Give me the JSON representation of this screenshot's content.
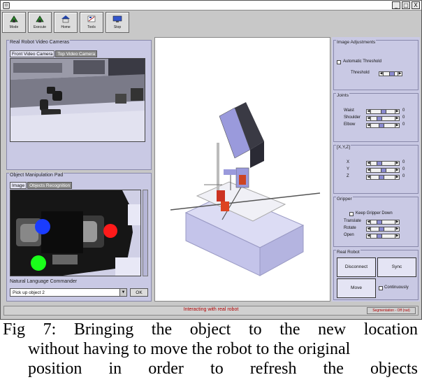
{
  "window": {
    "icon": "app-icon",
    "controls": [
      "_",
      "□",
      "X"
    ]
  },
  "toolbar": {
    "buttons": [
      {
        "label": "Mode",
        "icon": "green-arrow-icon"
      },
      {
        "label": "Execute",
        "icon": "green-arrow-icon"
      },
      {
        "label": "Home",
        "icon": "house-icon"
      },
      {
        "label": "Tools",
        "icon": "tools-icon"
      },
      {
        "label": "Stop",
        "icon": "monitor-icon"
      }
    ]
  },
  "cameras": {
    "title": "Real Robot Video Cameras",
    "tabs": [
      "Front Video Camera",
      "Top Video Camera"
    ]
  },
  "manipulation": {
    "title": "Object Manipulation Pad",
    "tabs": [
      "Image",
      "Objects Recognition"
    ]
  },
  "commander": {
    "title": "Natural Language Commander",
    "value": "Pick up object 2",
    "ok_label": "OK"
  },
  "image_adjustments": {
    "title": "Image Adjustments",
    "auto_threshold_label": "Automatic Threshold",
    "threshold_label": "Threshold"
  },
  "joints": {
    "title": "Joints",
    "rows": [
      {
        "label": "Waist",
        "value": "0.5",
        "value_readout": "0"
      },
      {
        "label": "Shoulder",
        "value": "0.3",
        "value_readout": "0"
      },
      {
        "label": "Elbow",
        "value": "0.4",
        "value_readout": "0"
      }
    ]
  },
  "xyz": {
    "title": "[X,Y,Z]",
    "rows": [
      {
        "label": "X",
        "value": "0.3",
        "value_readout": "0"
      },
      {
        "label": "Y",
        "value": "0.5",
        "value_readout": "0"
      },
      {
        "label": "Z",
        "value": "0.4",
        "value_readout": "0"
      }
    ]
  },
  "gripper": {
    "title": "Gripper",
    "keep_down_label": "Keep Gripper Down",
    "rows": [
      {
        "label": "Translate",
        "value": "0.3"
      },
      {
        "label": "Rotate",
        "value": "0.4"
      },
      {
        "label": "Open",
        "value": "0.3"
      }
    ]
  },
  "real_robot": {
    "title": "Real Robot",
    "disconnect_label": "Disconnect",
    "sync_label": "Sync",
    "move_label": "Move",
    "continuously_label": "Continuously"
  },
  "status": {
    "text": "Interacting with real robot",
    "right": "Segmentation - Off (nat)"
  },
  "caption": {
    "line1": "Fig 7: Bringing the object to the new location",
    "line2": "without having to move the robot to the original",
    "line3": "position in order to refresh the objects"
  },
  "colors": {
    "panel": "#c9c9e4",
    "status_text": "#b00000",
    "blob_blue": "#1a3cff",
    "blob_red": "#ff1a1a",
    "blob_green": "#1aff1a"
  }
}
